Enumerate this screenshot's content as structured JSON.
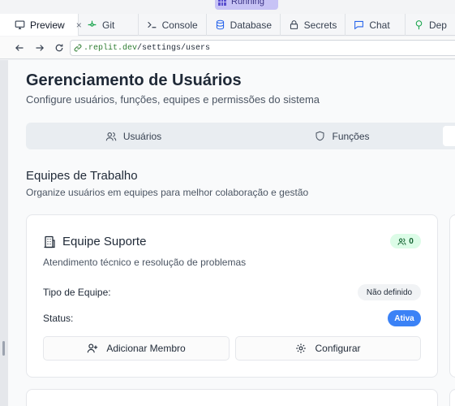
{
  "run_status": "Running",
  "tabs": [
    {
      "label": "Preview",
      "icon": "monitor-icon",
      "active": true
    },
    {
      "label": "Git",
      "icon": "git-icon"
    },
    {
      "label": "Console",
      "icon": "terminal-icon"
    },
    {
      "label": "Database",
      "icon": "database-icon"
    },
    {
      "label": "Secrets",
      "icon": "lock-icon"
    },
    {
      "label": "Chat",
      "icon": "chat-icon"
    },
    {
      "label": "Dep",
      "icon": "package-icon"
    }
  ],
  "tab_close": "×",
  "address": {
    "domain": ".replit.dev",
    "path": "/settings/users"
  },
  "page": {
    "title": "Gerenciamento de Usuários",
    "subtitle": "Configure usuários, funções, equipes e permissões do sistema",
    "segments": [
      {
        "label": "Usuários",
        "icon": "users-icon"
      },
      {
        "label": "Funções",
        "icon": "shield-icon"
      }
    ],
    "section_title": "Equipes de Trabalho",
    "section_subtitle": "Organize usuários em equipes para melhor colaboração e gestão",
    "team": {
      "name": "Equipe Suporte",
      "icon": "building-icon",
      "member_count": "0",
      "description": "Atendimento técnico e resolução de problemas",
      "type_label": "Tipo de Equipe:",
      "type_value": "Não definido",
      "status_label": "Status:",
      "status_value": "Ativa",
      "add_member_label": "Adicionar Membro",
      "configure_label": "Configurar"
    }
  },
  "colors": {
    "accent": "#3b82f6",
    "success_bg": "#dcfce7",
    "success_fg": "#166534",
    "running": "#c7c3f5"
  }
}
